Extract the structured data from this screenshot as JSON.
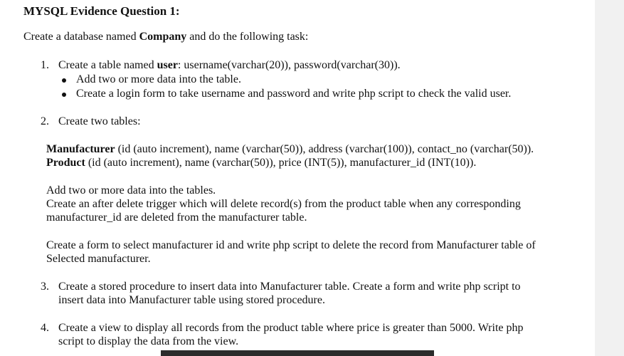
{
  "heading": "MYSQL Evidence Question 1:",
  "intro": {
    "prefix": "Create a database named ",
    "db_name": "Company",
    "suffix": " and do the following task:"
  },
  "items": [
    {
      "number": "1.",
      "line_prefix": "Create a table named ",
      "line_bold": "user",
      "line_suffix": ": username(varchar(20)), password(varchar(30)).",
      "bullets": [
        "Add two or more data into the table.",
        "Create a login form to take username and password and write php script to check the valid user."
      ]
    },
    {
      "number": "2.",
      "line": "Create two tables:",
      "manufacturer_label": "Manufacturer",
      "manufacturer_rest": " (id (auto increment), name (varchar(50)), address (varchar(100)), contact_no (varchar(50)).",
      "product_label": "Product",
      "product_rest": " (id (auto increment), name (varchar(50)), price (INT(5)), manufacturer_id (INT(10)).",
      "para1_line1": "Add two or more data into the tables.",
      "para1_line2": "Create an after delete trigger which will delete record(s) from the product table when any corresponding",
      "para1_line3": "manufacturer_id are deleted from the manufacturer table.",
      "para2_line1": "Create a form to select manufacturer id and write php script to delete the record from Manufacturer table of",
      "para2_line2": "Selected manufacturer."
    },
    {
      "number": "3.",
      "line1": "Create a stored procedure to insert data into Manufacturer table. Create a form and write php script to",
      "line2": "insert data into Manufacturer table using stored procedure."
    },
    {
      "number": "4.",
      "line1": "Create a view to display all records from the product table where price is greater than 5000. Write php",
      "line2": "script to display the data from the view."
    }
  ]
}
